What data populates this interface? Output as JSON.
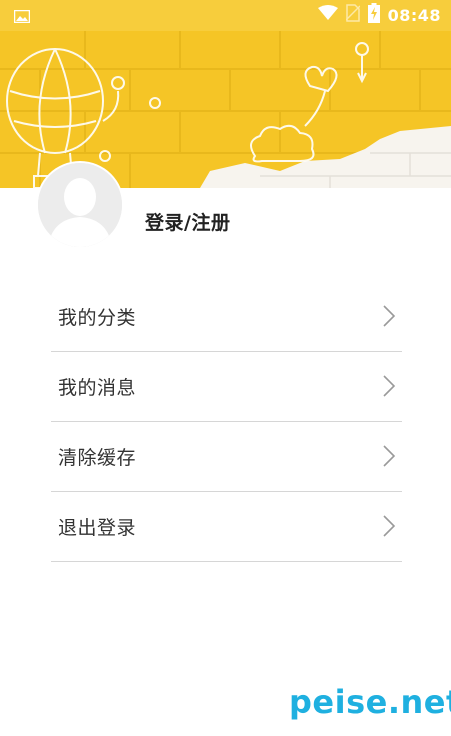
{
  "status_bar": {
    "time": "08:48",
    "icons": [
      "image-icon",
      "wifi-icon",
      "no-sim-icon",
      "battery-charging-icon"
    ]
  },
  "profile": {
    "login_label": "登录/注册",
    "avatar_icon": "default-avatar-icon"
  },
  "menu": {
    "items": [
      {
        "label": "我的分类",
        "icon": "chevron-right-icon"
      },
      {
        "label": "我的消息",
        "icon": "chevron-right-icon"
      },
      {
        "label": "清除缓存",
        "icon": "chevron-right-icon"
      },
      {
        "label": "退出登录",
        "icon": "chevron-right-icon"
      }
    ]
  },
  "watermark": {
    "text": "peise.net"
  },
  "colors": {
    "status_bar": "#f7cd3c",
    "banner": "#f5c526",
    "divider": "#d6d6d6",
    "watermark": "#1fb0e0"
  }
}
